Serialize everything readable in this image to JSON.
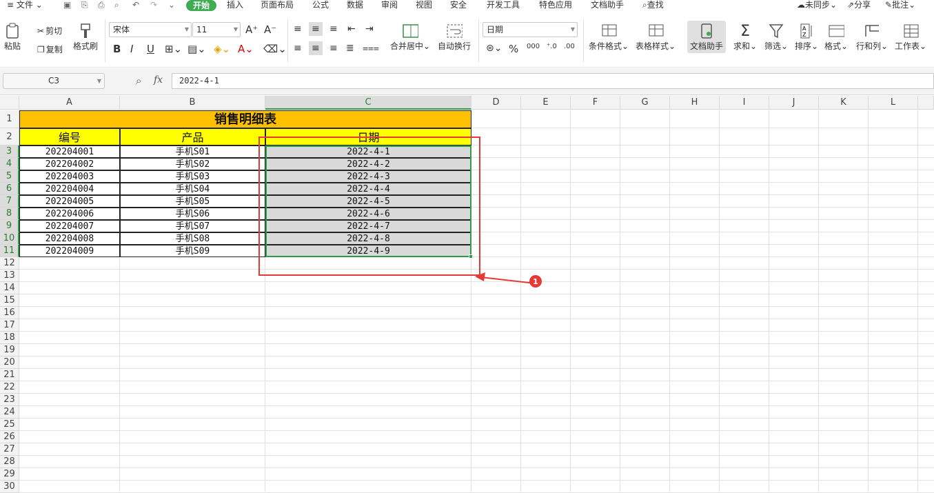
{
  "menu": {
    "file": "文件",
    "tabs": [
      "开始",
      "插入",
      "页面布局",
      "公式",
      "数据",
      "审阅",
      "视图",
      "安全",
      "开发工具",
      "特色应用",
      "文档助手"
    ],
    "search": "查找",
    "sync": "未同步",
    "share": "分享",
    "comment": "批注"
  },
  "ribbon": {
    "paste": "粘贴",
    "cut": "剪切",
    "copy": "复制",
    "format_painter": "格式刷",
    "font_name": "宋体",
    "font_size": "11",
    "merge_center": "合并居中",
    "wrap_text": "自动换行",
    "number_format": "日期",
    "conditional_format": "条件格式",
    "table_style": "表格样式",
    "doc_assistant": "文档助手",
    "sum": "求和",
    "filter": "筛选",
    "sort": "排序",
    "format": "格式",
    "row_col": "行和列",
    "worksheet": "工作表"
  },
  "formula_bar": {
    "name_box": "C3",
    "fx": "fx",
    "content": "2022-4-1"
  },
  "sheet": {
    "columns": [
      "A",
      "B",
      "C",
      "D",
      "E",
      "F",
      "G",
      "H",
      "I",
      "J",
      "K",
      "L"
    ],
    "rows": [
      "1",
      "2",
      "3",
      "4",
      "5",
      "6",
      "7",
      "8",
      "9",
      "10",
      "11",
      "12",
      "13",
      "14",
      "15",
      "16",
      "17",
      "18",
      "19",
      "20",
      "21",
      "22",
      "23",
      "24",
      "25",
      "26",
      "27",
      "28",
      "29",
      "30"
    ],
    "title": "销售明细表",
    "headers": [
      "编号",
      "产品",
      "日期"
    ],
    "data": [
      [
        "202204001",
        "手机S01",
        "2022-4-1"
      ],
      [
        "202204002",
        "手机S02",
        "2022-4-2"
      ],
      [
        "202204003",
        "手机S03",
        "2022-4-3"
      ],
      [
        "202204004",
        "手机S04",
        "2022-4-4"
      ],
      [
        "202204005",
        "手机S05",
        "2022-4-5"
      ],
      [
        "202204006",
        "手机S06",
        "2022-4-6"
      ],
      [
        "202204007",
        "手机S07",
        "2022-4-7"
      ],
      [
        "202204008",
        "手机S08",
        "2022-4-8"
      ],
      [
        "202204009",
        "手机S09",
        "2022-4-9"
      ]
    ]
  },
  "annotation": {
    "marker": "1"
  },
  "colors": {
    "accent": "#3fab53",
    "title_bg": "#ffc000",
    "header_bg": "#ffff00",
    "selection_bg": "#d9d9d9",
    "annotation": "#e53935"
  }
}
